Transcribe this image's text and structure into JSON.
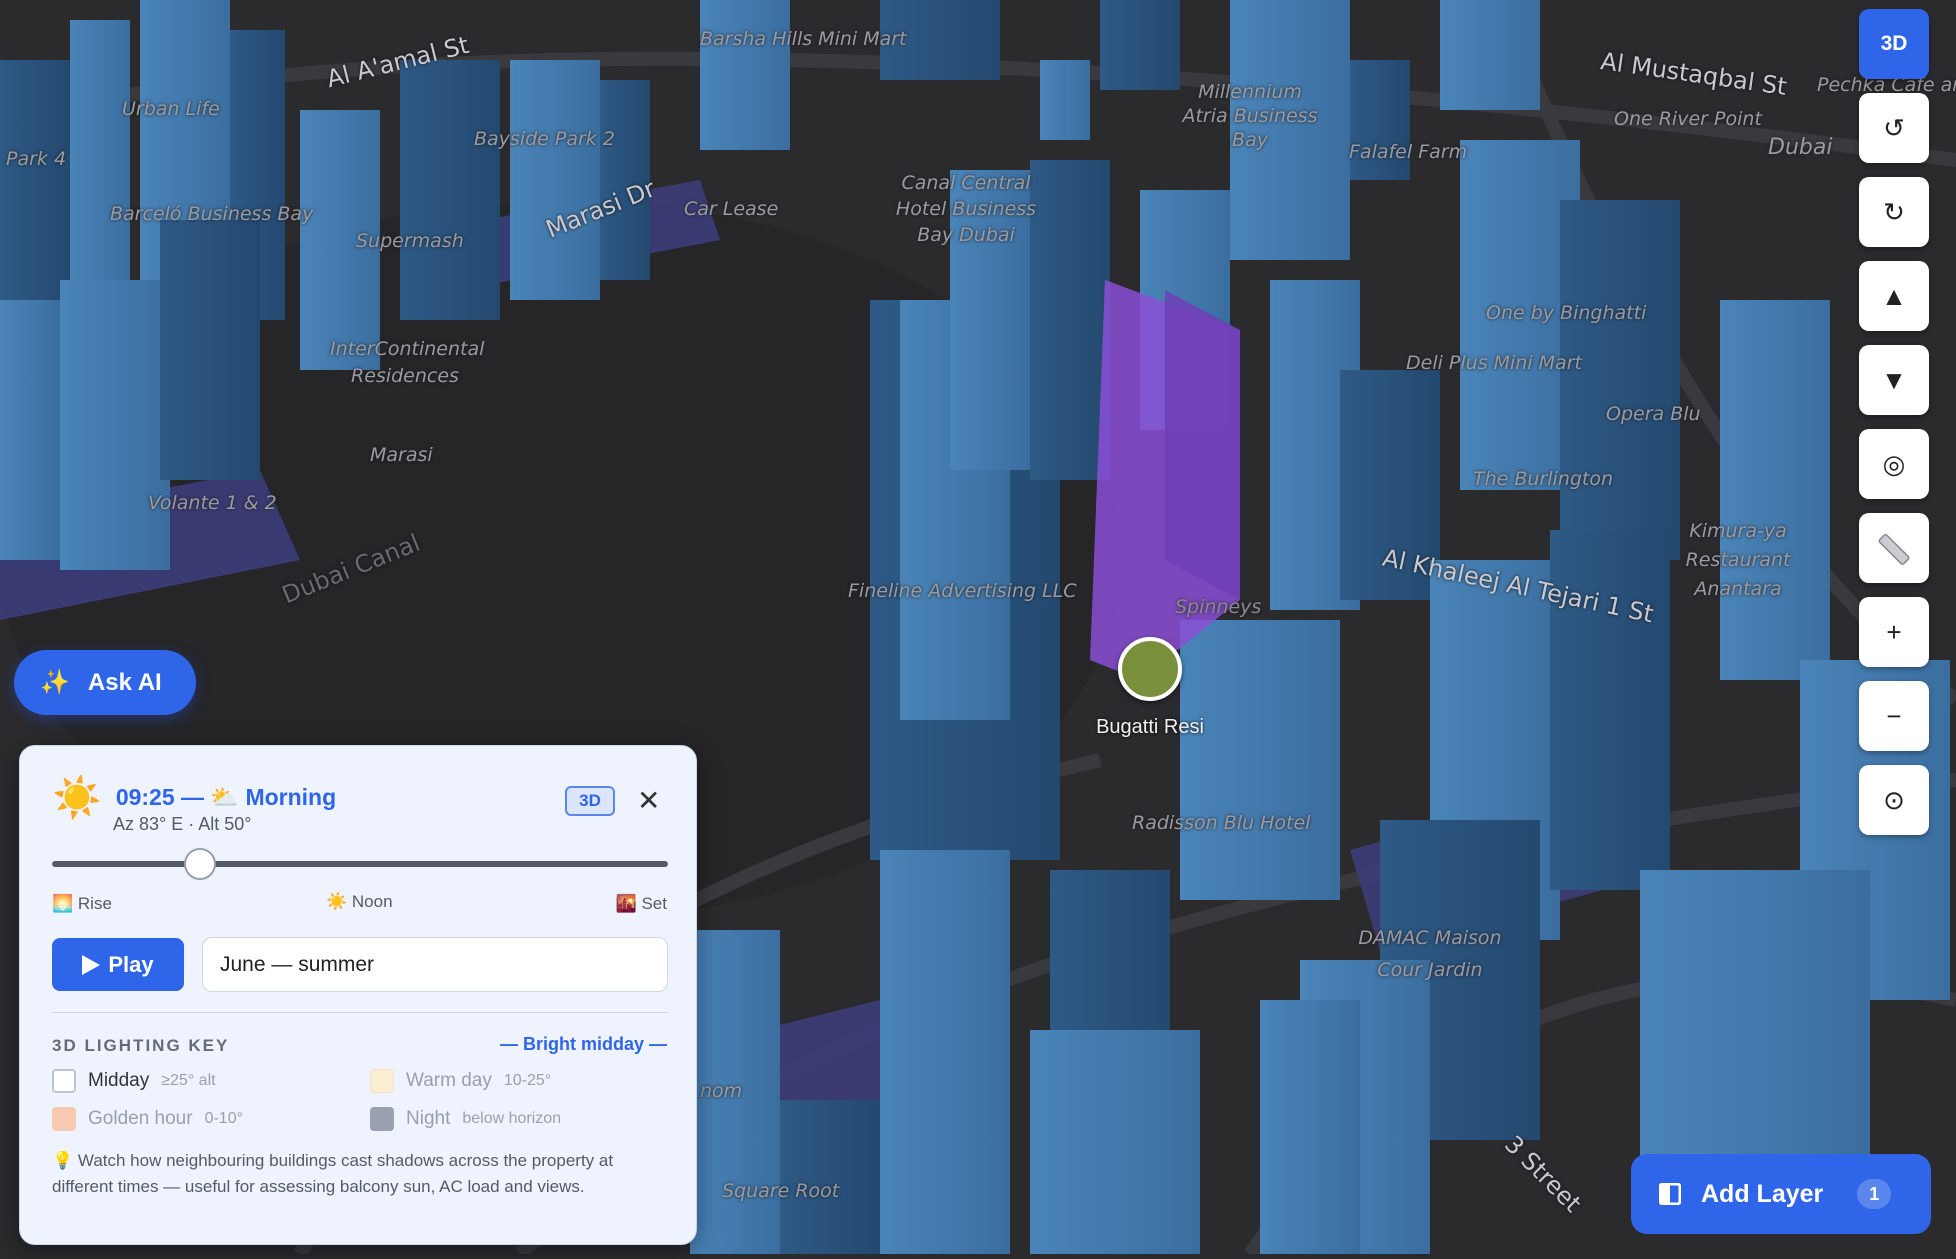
{
  "map": {
    "labels": [
      "Barsha Hills Mini Mart",
      "Al A'amal St",
      "Urban Life",
      "Park 4",
      "Bayside Park 2",
      "Barceló Business Bay",
      "Supermash",
      "Marasi Dr",
      "Car Lease",
      "Canal Central Hotel Business Bay Dubai",
      "Millennium Atria Business Bay",
      "Falafel Farm",
      "One River Point",
      "Pechka Cafe and",
      "InterContinental Residences",
      "Marasi",
      "Volante 1 & 2",
      "Dubai Canal",
      "One by Binghatti",
      "Deli Plus Mini Mart",
      "Opera Blu",
      "The Burlington",
      "Kimura-ya Restaurant Anantara",
      "Al Khaleej Al Tejari 1 St",
      "Fineline Advertising LLC",
      "Spinneys",
      "Radisson Blu Hotel",
      "DAMAC Maison Cour Jardin",
      "3 Street",
      "Square Root",
      "Al Mustaqbal St",
      "Dubai",
      "nom"
    ],
    "marker": {
      "label": "Bugatti Resi",
      "color": "#7a8f3c"
    }
  },
  "controls": {
    "mode_3d": "3D",
    "rotate_left": "↺",
    "rotate_right": "↻",
    "tilt_up": "▲",
    "tilt_down": "▼",
    "compass": "◎",
    "measure": "ruler-icon",
    "zoom_in": "+",
    "zoom_out": "−",
    "locate": "⊙"
  },
  "ask_ai": {
    "icon": "✨",
    "label": "Ask AI"
  },
  "sun_panel": {
    "icon": "☀️",
    "title": "09:25 — ⛅ Morning",
    "subtitle": "Az 83° E · Alt 50°",
    "badge": "3D",
    "close": "✕",
    "slider_progress": 0.24,
    "marks": {
      "rise": "🌅 Rise",
      "noon": "☀️ Noon",
      "set": "🌇 Set"
    },
    "play_label": "Play",
    "season_value": "June — summer",
    "key_title": "3D LIGHTING KEY",
    "key_state": "— Bright midday —",
    "legend": [
      {
        "label": "Midday",
        "note": "≥25° alt",
        "color": "#ffffff"
      },
      {
        "label": "Warm day",
        "note": "10-25°",
        "color": "#fbeed5"
      },
      {
        "label": "Golden hour",
        "note": "0-10°",
        "color": "#f6c9b0"
      },
      {
        "label": "Night",
        "note": "below horizon",
        "color": "#9aa0b0"
      }
    ],
    "tip_icon": "💡",
    "tip": "Watch how neighbouring buildings cast shadows across the property at different times — useful for assessing balcony sun, AC load and views."
  },
  "add_layer": {
    "label": "Add Layer",
    "count": "1"
  },
  "colors": {
    "accent": "#2f66e9",
    "building": "#3a6fa0",
    "highlight": "#8b4fd6",
    "ground": "#2b2b2e"
  }
}
